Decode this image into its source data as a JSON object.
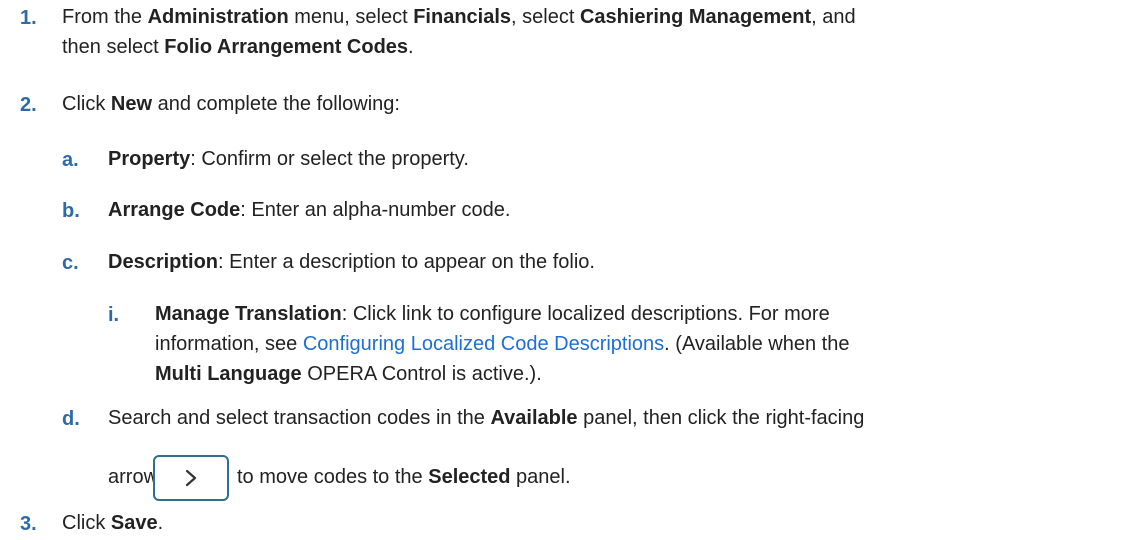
{
  "steps": [
    {
      "num": "1.",
      "line1": [
        "From the ",
        "Administration",
        " menu, select ",
        "Financials",
        ", select ",
        "Cashiering Management",
        ", and"
      ],
      "line2": [
        "then select ",
        "Folio Arrangement Codes",
        "."
      ]
    },
    {
      "num": "2.",
      "line1": [
        "Click ",
        "New",
        " and complete the following:"
      ]
    },
    {
      "num": "a.",
      "line1": [
        "Property",
        ": Confirm or select the property."
      ]
    },
    {
      "num": "b.",
      "line1": [
        "Arrange Code",
        ": Enter an alpha-number code."
      ]
    },
    {
      "num": "c.",
      "line1": [
        "Description",
        ": Enter a description to appear on the folio."
      ]
    },
    {
      "num": "i.",
      "line1": [
        "Manage Translation",
        ": Click link to configure localized descriptions. For more"
      ],
      "line2": [
        "information, see ",
        "Configuring Localized Code Descriptions",
        ". (Available when the"
      ],
      "line3": [
        "Multi Language",
        " OPERA Control is active.)."
      ]
    },
    {
      "num": "d.",
      "line1": [
        "Search and select transaction codes in the ",
        "Available",
        " panel, then click the right-facing"
      ],
      "line2": [
        "arrow",
        "to move codes to the ",
        "Selected",
        " panel."
      ]
    },
    {
      "num": "3.",
      "line1": [
        "Click ",
        "Save",
        "."
      ]
    }
  ],
  "icons": {
    "arrow_button": "chevron-right-icon"
  },
  "colors": {
    "step_number": "#2d6ba8",
    "link": "#1f6fd1",
    "button_border": "#2d7288"
  }
}
